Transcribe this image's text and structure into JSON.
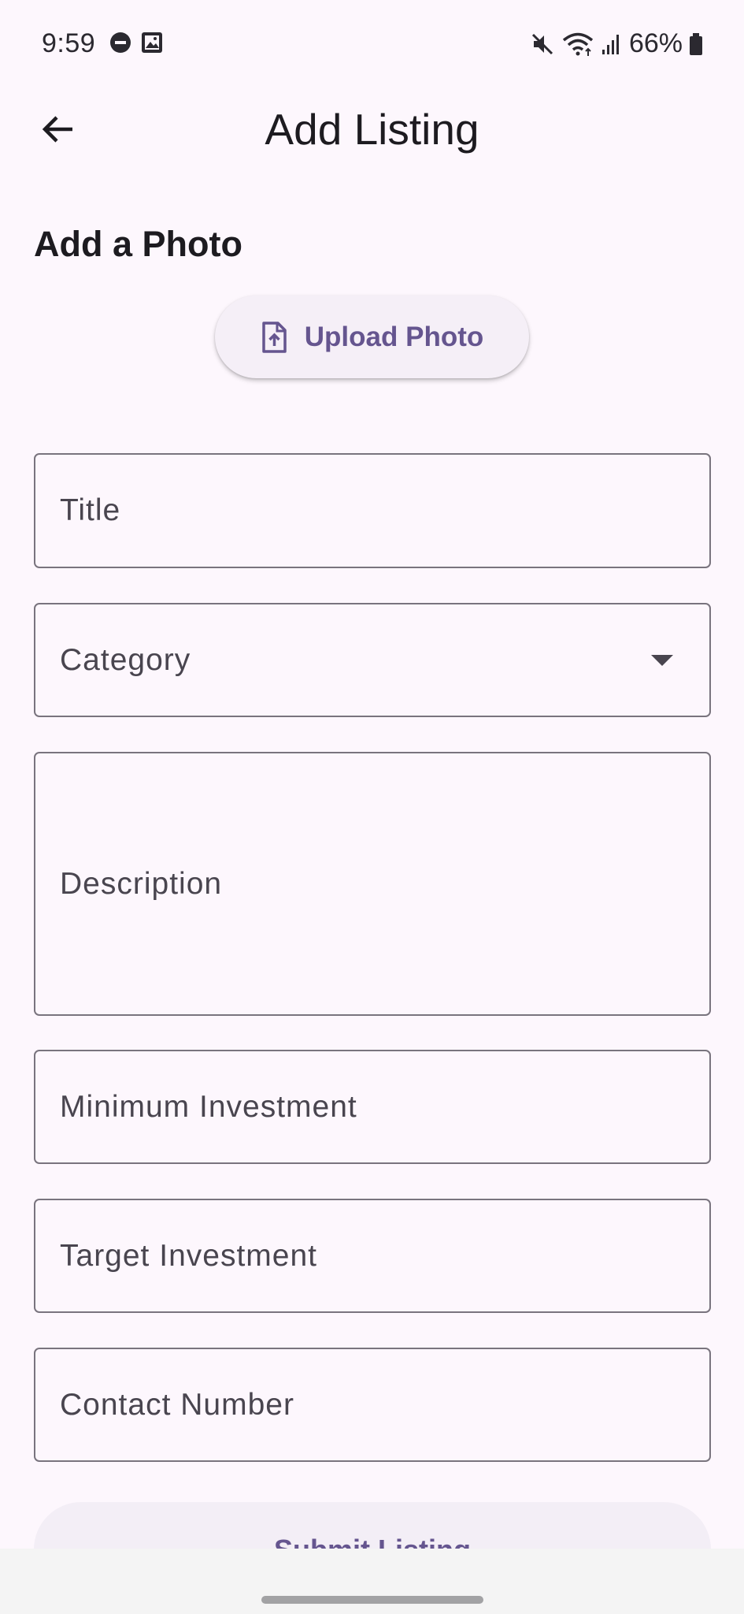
{
  "status_bar": {
    "time": "9:59",
    "battery": "66%",
    "icons": [
      "do-not-disturb-icon",
      "gallery-icon",
      "mute-icon",
      "wifi-icon",
      "signal-icon",
      "battery-icon"
    ]
  },
  "app_bar": {
    "title": "Add Listing",
    "back_icon": "arrow-back-icon"
  },
  "photo_section": {
    "heading": "Add a Photo",
    "upload_label": "Upload Photo",
    "upload_icon": "file-upload-icon"
  },
  "form": {
    "title_label": "Title",
    "category_label": "Category",
    "description_label": "Description",
    "minimum_investment_label": "Minimum Investment",
    "target_investment_label": "Target Investment",
    "contact_number_label": "Contact Number",
    "submit_label": "Submit Listing"
  },
  "colors": {
    "background": "#fdf7fd",
    "accent": "#65558f",
    "outline": "#79747e"
  }
}
